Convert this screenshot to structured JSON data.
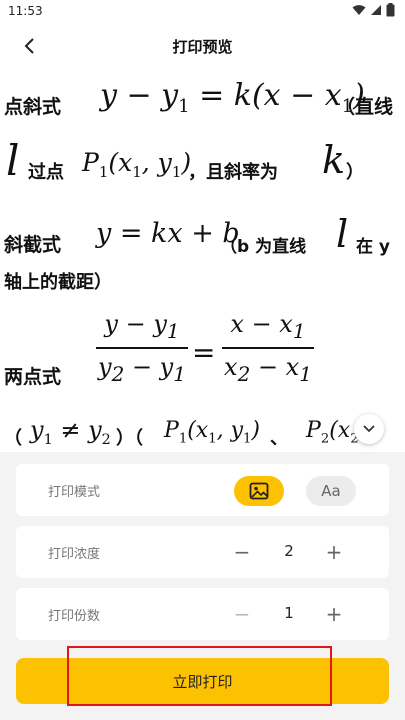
{
  "status_bar": {
    "time": "11:53"
  },
  "header": {
    "title": "打印预览"
  },
  "formulas": {
    "point_slope": {
      "label": "点斜式",
      "equation_left": "y − y",
      "sub1": "1",
      "equation_mid": " = k(x − x",
      "sub2": "1",
      "equation_end": ")",
      "paren_open": "（直线",
      "l": "l",
      "through": "过点",
      "point": "P",
      "p_sub": "1",
      "point_coords": "(x",
      "x_sub": "1",
      "comma": ", y",
      "y_sub": "1",
      "close": ")",
      "slope_text": "，且斜率为",
      "k": "k",
      "paren_close": "）"
    },
    "slope_intercept": {
      "label": "斜截式",
      "equation": "y = kx + b",
      "note_a": "（b 为直线",
      "l": "l",
      "note_b": "在 y",
      "note_c": "轴上的截距）"
    },
    "two_point": {
      "label": "两点式",
      "num_left": "y − y",
      "num_left_sub": "1",
      "den_left": "y",
      "den_left_sub2": "2",
      "den_left_mid": " − y",
      "den_left_sub1": "1",
      "equals": "=",
      "num_right": "x − x",
      "num_right_sub": "1",
      "den_right": "x",
      "den_right_sub2": "2",
      "den_right_mid": " − x",
      "den_right_sub1": "1"
    },
    "condition": {
      "open": "（",
      "y1": "y",
      "y1_sub": "1",
      "neq": " ≠ y",
      "y2_sub": "2",
      "close": "）（",
      "p1": "P",
      "p1_sub": "1",
      "p1_coords": "(x",
      "p1_x_sub": "1",
      "p1_comma": ", y",
      "p1_y_sub": "1",
      "p1_close": ")",
      "sep": "、",
      "p2": "P",
      "p2_sub": "2",
      "p2_coords": "(x",
      "p2_x_sub": "2",
      "tail": ")"
    }
  },
  "settings": {
    "print_mode": {
      "label": "打印模式"
    },
    "mode_text_label": "Aa",
    "density": {
      "label": "打印浓度",
      "minus": "−",
      "value": "2",
      "plus": "+"
    },
    "copies": {
      "label": "打印份数",
      "minus": "−",
      "value": "1",
      "plus": "+"
    }
  },
  "actions": {
    "print_now": "立即打印"
  },
  "colors": {
    "accent": "#fcc101",
    "highlight": "#e0181b",
    "panel_bg": "#f3f3f3"
  }
}
